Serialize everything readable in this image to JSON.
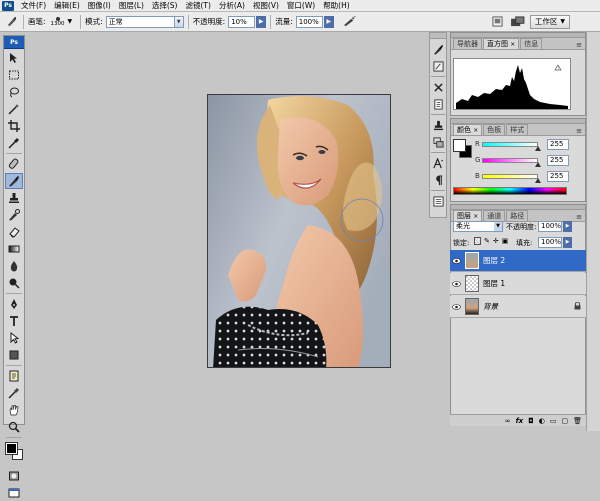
{
  "app": {
    "logo": "Ps"
  },
  "menu": [
    "文件(F)",
    "编辑(E)",
    "图像(I)",
    "图层(L)",
    "选择(S)",
    "滤镜(T)",
    "分析(A)",
    "视图(V)",
    "窗口(W)",
    "帮助(H)"
  ],
  "options": {
    "brush_label": "画笔:",
    "brush_size": "1300",
    "mode_label": "模式:",
    "mode_value": "正常",
    "opacity_label": "不透明度:",
    "opacity_value": "10%",
    "flow_label": "流量:",
    "flow_value": "100%",
    "workspace_label": "工作区"
  },
  "nav_panel": {
    "tabs": [
      "导航器",
      "直方图",
      "信息"
    ],
    "active_tab": 1
  },
  "color_panel": {
    "tabs": [
      "颜色",
      "色板",
      "样式"
    ],
    "channels": [
      {
        "name": "R",
        "value": "255",
        "color": "#00c8c8"
      },
      {
        "name": "G",
        "value": "255",
        "color": "#d000d0"
      },
      {
        "name": "B",
        "value": "255",
        "color": "#e0e000"
      }
    ]
  },
  "layers_panel": {
    "tabs": [
      "图层",
      "通道",
      "路径"
    ],
    "blend_mode": "柔光",
    "opacity_label": "不透明度:",
    "opacity_value": "100%",
    "lock_label": "锁定:",
    "fill_label": "填充:",
    "fill_value": "100%",
    "layers": [
      {
        "name": "图层 2",
        "selected": true
      },
      {
        "name": "图层 1",
        "selected": false
      },
      {
        "name": "背景",
        "selected": false
      }
    ],
    "bottom_icons": [
      "link-icon",
      "fx-icon",
      "mask-icon",
      "adjustment-icon",
      "folder-icon",
      "new-layer-icon",
      "trash-icon"
    ]
  },
  "colors": {
    "menu_bg": "#ececec",
    "canvas_bg": "#c6c6c6",
    "selection_blue": "#3169c6",
    "toolbox_header": "#1e5db5"
  }
}
